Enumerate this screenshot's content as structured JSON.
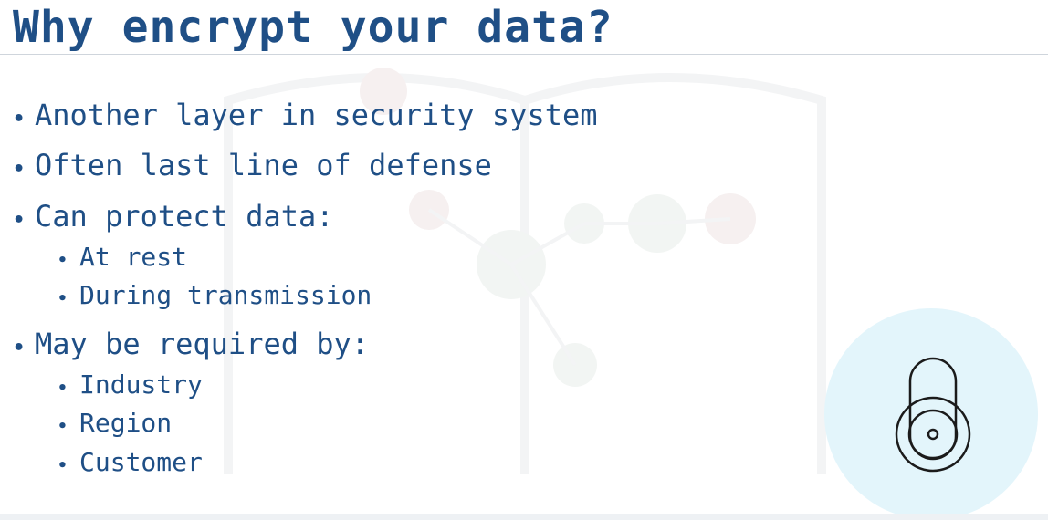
{
  "slide": {
    "title": "Why encrypt your data?",
    "bullet_marker": "•",
    "bullets": [
      {
        "text": "Another layer in security system"
      },
      {
        "text": "Often last line of defense"
      },
      {
        "text": "Can protect data:",
        "sub": [
          "At rest",
          "During transmission"
        ]
      },
      {
        "text": "May be required by:",
        "sub": [
          "Industry",
          "Region",
          "Customer"
        ]
      }
    ]
  },
  "colors": {
    "title_text": "#1f4f86",
    "body_text": "#1f4f86",
    "badge_background": "#e3f5fb",
    "icon_stroke": "#1b1b1b"
  },
  "icons": {
    "lock": "lock-icon"
  }
}
